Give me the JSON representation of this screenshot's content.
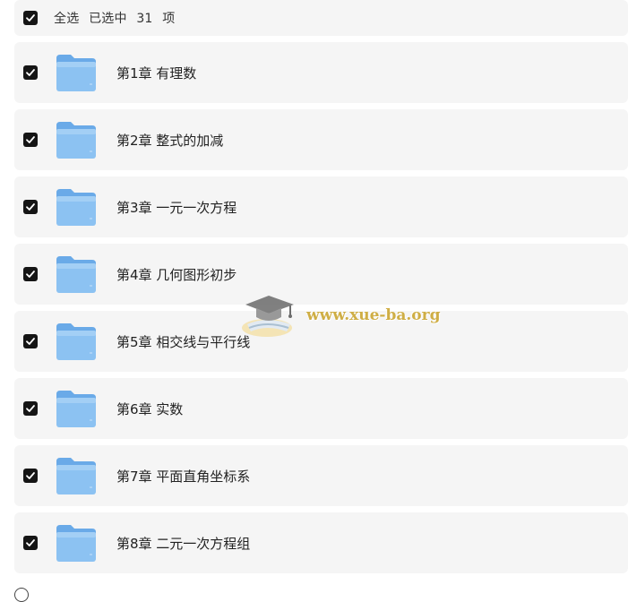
{
  "select_all": {
    "label": "全选",
    "selected_prefix": "已选中",
    "selected_count": "31",
    "selected_suffix": "项",
    "checked": true
  },
  "items": [
    {
      "label": "第1章 有理数",
      "checked": true,
      "icon": "folder-icon"
    },
    {
      "label": "第2章 整式的加减",
      "checked": true,
      "icon": "folder-icon"
    },
    {
      "label": "第3章 一元一次方程",
      "checked": true,
      "icon": "folder-icon"
    },
    {
      "label": "第4章 几何图形初步",
      "checked": true,
      "icon": "folder-icon"
    },
    {
      "label": "第5章 相交线与平行线",
      "checked": true,
      "icon": "folder-icon"
    },
    {
      "label": "第6章 实数",
      "checked": true,
      "icon": "folder-icon"
    },
    {
      "label": "第7章 平面直角坐标系",
      "checked": true,
      "icon": "folder-icon"
    },
    {
      "label": "第8章 二元一次方程组",
      "checked": true,
      "icon": "folder-icon"
    }
  ],
  "watermark": {
    "text": "www.xue-ba.org",
    "icon": "graduation-cap-logo"
  },
  "colors": {
    "row_background": "#f5f5f5",
    "checkbox": "#151515",
    "folder_blue": "#7fb8ef",
    "watermark_gold": "#c9a227"
  }
}
